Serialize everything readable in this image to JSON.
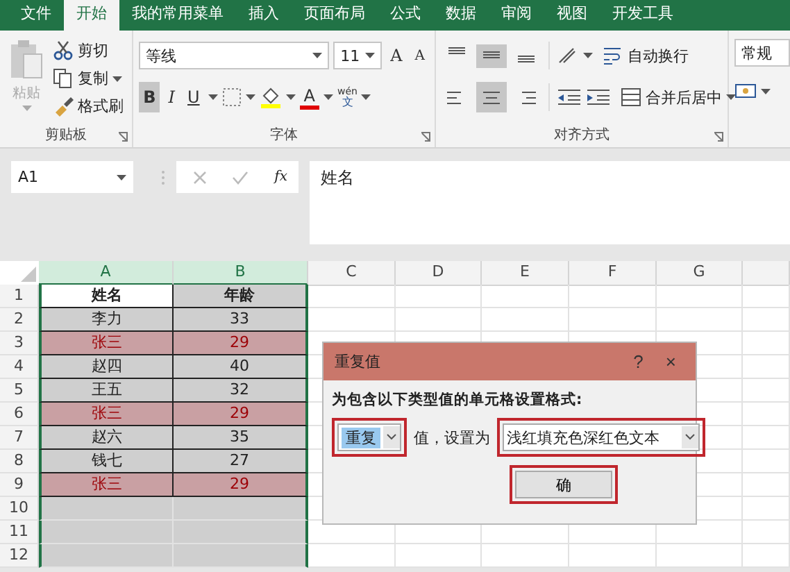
{
  "tabs": [
    {
      "label": "文件",
      "selected": false
    },
    {
      "label": "开始",
      "selected": true
    },
    {
      "label": "我的常用菜单",
      "selected": false
    },
    {
      "label": "插入",
      "selected": false
    },
    {
      "label": "页面布局",
      "selected": false
    },
    {
      "label": "公式",
      "selected": false
    },
    {
      "label": "数据",
      "selected": false
    },
    {
      "label": "审阅",
      "selected": false
    },
    {
      "label": "视图",
      "selected": false
    },
    {
      "label": "开发工具",
      "selected": false
    }
  ],
  "ribbon": {
    "clipboard": {
      "paste": "粘贴",
      "items": [
        {
          "label": "剪切",
          "kind": "cut",
          "dropdown": false
        },
        {
          "label": "复制",
          "kind": "copy",
          "dropdown": true
        },
        {
          "label": "格式刷",
          "kind": "brush",
          "dropdown": false
        }
      ],
      "group_label": "剪贴板"
    },
    "font": {
      "font_name": "等线",
      "font_size": "11",
      "grow": "A",
      "shrink": "A",
      "styles": [
        {
          "label": "B",
          "kind": "bold",
          "selected": true
        },
        {
          "label": "I",
          "kind": "italic",
          "selected": false
        },
        {
          "label": "U",
          "kind": "underline",
          "selected": false
        }
      ],
      "font_color_label": "A",
      "phonetic": [
        "wén",
        "文"
      ],
      "group_label": "字体"
    },
    "alignment": {
      "vertical": [
        {
          "kind": "top",
          "selected": false
        },
        {
          "kind": "middle",
          "selected": true
        },
        {
          "kind": "bottom",
          "selected": false
        }
      ],
      "horizontal": [
        {
          "kind": "left",
          "selected": false
        },
        {
          "kind": "center",
          "selected": true
        },
        {
          "kind": "right",
          "selected": false
        }
      ],
      "wrap": "自动换行",
      "merge": "合并后居中",
      "group_label": "对齐方式"
    },
    "number": {
      "format": "常规"
    }
  },
  "formula_bar": {
    "name_box": "A1",
    "function_label": "fx",
    "content": "姓名"
  },
  "sheet": {
    "columns": [
      {
        "label": "A",
        "selected": true
      },
      {
        "label": "B",
        "selected": true
      },
      {
        "label": "C",
        "selected": false
      },
      {
        "label": "D",
        "selected": false
      },
      {
        "label": "E",
        "selected": false
      },
      {
        "label": "F",
        "selected": false
      },
      {
        "label": "G",
        "selected": false
      }
    ],
    "rows": [
      {
        "number": "1",
        "kind": "header",
        "cells": [
          {
            "text": "姓名",
            "active": true
          },
          {
            "text": "年龄",
            "active": false
          }
        ]
      },
      {
        "number": "2",
        "kind": "value",
        "cells": [
          {
            "text": "李力",
            "active": false
          },
          {
            "text": "33",
            "active": false
          }
        ]
      },
      {
        "number": "3",
        "kind": "duplicate",
        "cells": [
          {
            "text": "张三",
            "active": false
          },
          {
            "text": "29",
            "active": false
          }
        ]
      },
      {
        "number": "4",
        "kind": "value",
        "cells": [
          {
            "text": "赵四",
            "active": false
          },
          {
            "text": "40",
            "active": false
          }
        ]
      },
      {
        "number": "5",
        "kind": "value",
        "cells": [
          {
            "text": "王五",
            "active": false
          },
          {
            "text": "32",
            "active": false
          }
        ]
      },
      {
        "number": "6",
        "kind": "duplicate",
        "cells": [
          {
            "text": "张三",
            "active": false
          },
          {
            "text": "29",
            "active": false
          }
        ]
      },
      {
        "number": "7",
        "kind": "value",
        "cells": [
          {
            "text": "赵六",
            "active": false
          },
          {
            "text": "35",
            "active": false
          }
        ]
      },
      {
        "number": "8",
        "kind": "value",
        "cells": [
          {
            "text": "钱七",
            "active": false
          },
          {
            "text": "27",
            "active": false
          }
        ]
      },
      {
        "number": "9",
        "kind": "duplicate",
        "cells": [
          {
            "text": "张三",
            "active": false
          },
          {
            "text": "29",
            "active": false
          }
        ]
      },
      {
        "number": "10",
        "kind": "empty"
      },
      {
        "number": "11",
        "kind": "empty"
      },
      {
        "number": "12",
        "kind": "empty"
      }
    ]
  },
  "dialog": {
    "title": "重复值",
    "help": "?",
    "close": "×",
    "prompt": "为包含以下类型值的单元格设置格式:",
    "rule": {
      "value": "重复",
      "highlighted": true
    },
    "connector": "值，设置为",
    "format": {
      "value": "浅红填充色深红色文本",
      "highlighted": true
    },
    "ok": {
      "label": "确",
      "highlighted": true
    }
  }
}
